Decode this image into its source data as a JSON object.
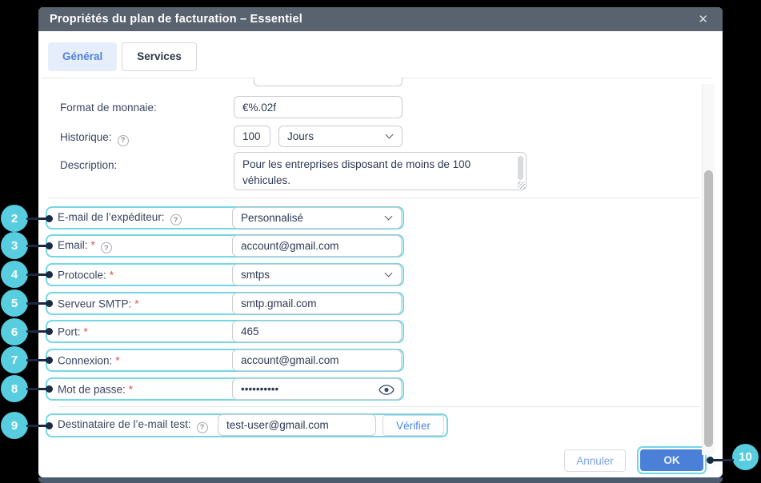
{
  "window": {
    "title": "Propriétés du plan de facturation – Essentiel"
  },
  "icons": {
    "close": "✕",
    "help": "?",
    "required": "*"
  },
  "tabs": {
    "general": "Général",
    "services": "Services"
  },
  "general_fields": {
    "currency_label": "Format de monnaie:",
    "currency_value": "€%.02f",
    "history_label": "Historique:",
    "history_value": "100",
    "history_unit": "Jours",
    "description_label": "Description:",
    "description_value": "Pour les entreprises disposant de moins de 100 véhicules."
  },
  "rows": [
    {
      "callout": "2",
      "label": "E-mail de l’expéditeur:",
      "value": "Personnalisé"
    },
    {
      "callout": "3",
      "label": "Email:",
      "value": "account@gmail.com"
    },
    {
      "callout": "4",
      "label": "Protocole:",
      "value": "smtps"
    },
    {
      "callout": "5",
      "label": "Serveur SMTP:",
      "value": "smtp.gmail.com"
    },
    {
      "callout": "6",
      "label": "Port:",
      "value": "465"
    },
    {
      "callout": "7",
      "label": "Connexion:",
      "value": "account@gmail.com"
    },
    {
      "callout": "8",
      "label": "Mot de passe:",
      "value": "••••••••••"
    },
    {
      "callout": "9",
      "label": "Destinataire de l’e-mail test:",
      "value": "test-user@gmail.com",
      "button": "Vérifier"
    }
  ],
  "footer": {
    "cancel": "Annuler",
    "ok": "OK",
    "ok_callout": "10"
  },
  "colors": {
    "accent_cyan": "#57cddf",
    "primary_blue": "#4a80d8",
    "header": "#59626f",
    "required_red": "#d9534f"
  }
}
